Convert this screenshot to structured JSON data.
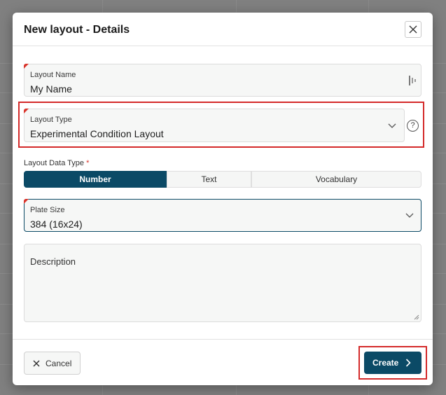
{
  "dialog": {
    "title": "New layout - Details"
  },
  "fields": {
    "layout_name": {
      "label": "Layout Name",
      "value": "My Name"
    },
    "layout_type": {
      "label": "Layout Type",
      "value": "Experimental Condition Layout"
    },
    "layout_data_type": {
      "label": "Layout Data Type",
      "required_mark": "*",
      "options": [
        "Number",
        "Text",
        "Vocabulary"
      ],
      "selected": "Number"
    },
    "plate_size": {
      "label": "Plate Size",
      "value": "384 (16x24)"
    },
    "description": {
      "label": "Description"
    }
  },
  "footer": {
    "cancel_label": "Cancel",
    "create_label": "Create"
  },
  "icons": {
    "close": "close-icon",
    "help": "help-icon",
    "chevron": "chevron-down-icon",
    "name_field": "text-cursor-icon",
    "create_arrow": "chevron-right-icon"
  },
  "help_glyph": "?",
  "colors": {
    "primary": "#0b4a66",
    "required": "#d9342b",
    "highlight": "#d42a2a"
  }
}
